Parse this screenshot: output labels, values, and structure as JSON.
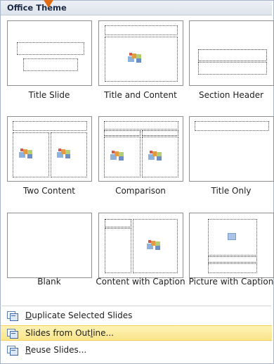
{
  "header": {
    "title": "Office Theme"
  },
  "layouts": [
    {
      "name": "Title Slide"
    },
    {
      "name": "Title and Content"
    },
    {
      "name": "Section Header"
    },
    {
      "name": "Two Content"
    },
    {
      "name": "Comparison"
    },
    {
      "name": "Title Only"
    },
    {
      "name": "Blank"
    },
    {
      "name": "Content with Caption"
    },
    {
      "name": "Picture with Caption"
    }
  ],
  "menu": {
    "items": [
      {
        "pre": "",
        "accel": "D",
        "post": "uplicate Selected Slides",
        "icon": "duplicate-slides-icon"
      },
      {
        "pre": "Slides from Out",
        "accel": "l",
        "post": "ine...",
        "icon": "slides-from-outline-icon",
        "highlighted": true
      },
      {
        "pre": "",
        "accel": "R",
        "post": "euse Slides...",
        "icon": "reuse-slides-icon"
      }
    ]
  },
  "colors": {
    "hover_bg": "#fbe58a",
    "header_bg": "#dde3ec",
    "accent_cursor": "#e36b13"
  }
}
